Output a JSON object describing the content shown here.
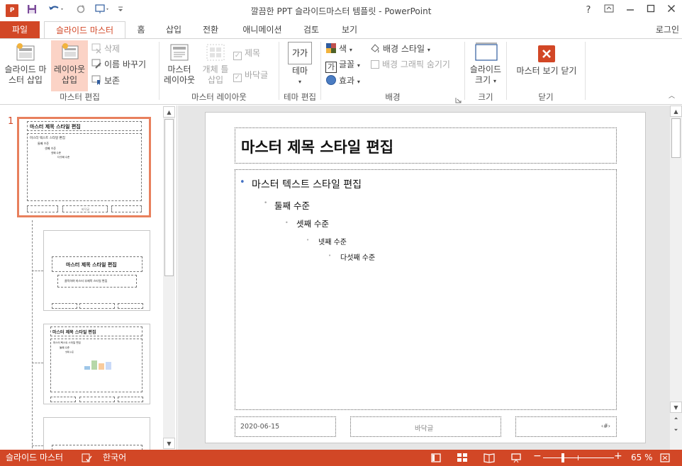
{
  "window": {
    "title": "깔끔한 PPT 슬라이드마스터 템플릿 - PowerPoint",
    "help": "?",
    "app_logo": "P"
  },
  "tabs": {
    "file": "파일",
    "items": [
      "슬라이드 마스터",
      "홈",
      "삽입",
      "전환",
      "애니메이션",
      "검토",
      "보기"
    ],
    "active": "슬라이드 마스터",
    "signin": "로그인"
  },
  "ribbon": {
    "master_edit": {
      "label": "마스터 편집",
      "insert_master": [
        "슬라이드 마",
        "스터 삽입"
      ],
      "insert_layout": [
        "레이아웃",
        "삽입"
      ],
      "delete": "삭제",
      "rename": "이름 바꾸기",
      "preserve": "보존"
    },
    "master_layout": {
      "label": "마스터 레이아웃",
      "master_layout_btn": [
        "마스터",
        "레이아웃"
      ],
      "insert_placeholder": [
        "개체 틀",
        "삽입"
      ],
      "title_check": "제목",
      "footer_check": "바닥글"
    },
    "theme_edit": {
      "label": "테마 편집",
      "theme_btn": "테마",
      "theme_icon_text": "가가"
    },
    "background": {
      "label": "배경",
      "colors": "색",
      "fonts": "글꼴",
      "effects": "효과",
      "bg_styles": "배경 스타일",
      "hide_bg": "배경 그래픽 숨기기",
      "fonts_icon_text": "가"
    },
    "size": {
      "label": "크기",
      "slide_size": [
        "슬라이드",
        "크기"
      ]
    },
    "close": {
      "label": "닫기",
      "close_master": "마스터 보기 닫기"
    }
  },
  "thumbnails": {
    "master_number": "1",
    "master_title": "마스터 제목 스타일 편집",
    "master_body": [
      "마스터 텍스트 스타일 편집",
      "둘째 수준",
      "셋째 수준",
      "넷째 수준",
      "다섯째 수준"
    ],
    "master_footer": "바닥글",
    "layout1_title": "마스터 제목 스타일 편집",
    "layout1_sub": "클릭하여 마스터 부제목 스타일 편집",
    "layout2_title": "마스터 제목 스타일 편집"
  },
  "slide": {
    "title": "마스터 제목 스타일 편집",
    "levels": [
      "마스터 텍스트 스타일 편집",
      "둘째 수준",
      "셋째 수준",
      "넷째 수준",
      "다섯째 수준"
    ],
    "date": "2020-06-15",
    "footer": "바닥글",
    "number": "‹#›"
  },
  "status": {
    "view": "슬라이드 마스터",
    "language": "한국어",
    "zoom": "65 %",
    "zoom_minus": "−",
    "zoom_plus": "+"
  },
  "colors": {
    "accent": "#d24726",
    "active_tab_text": "#d24726",
    "selected_button": "#fbd3c6",
    "thumb_border": "#e8805d"
  }
}
